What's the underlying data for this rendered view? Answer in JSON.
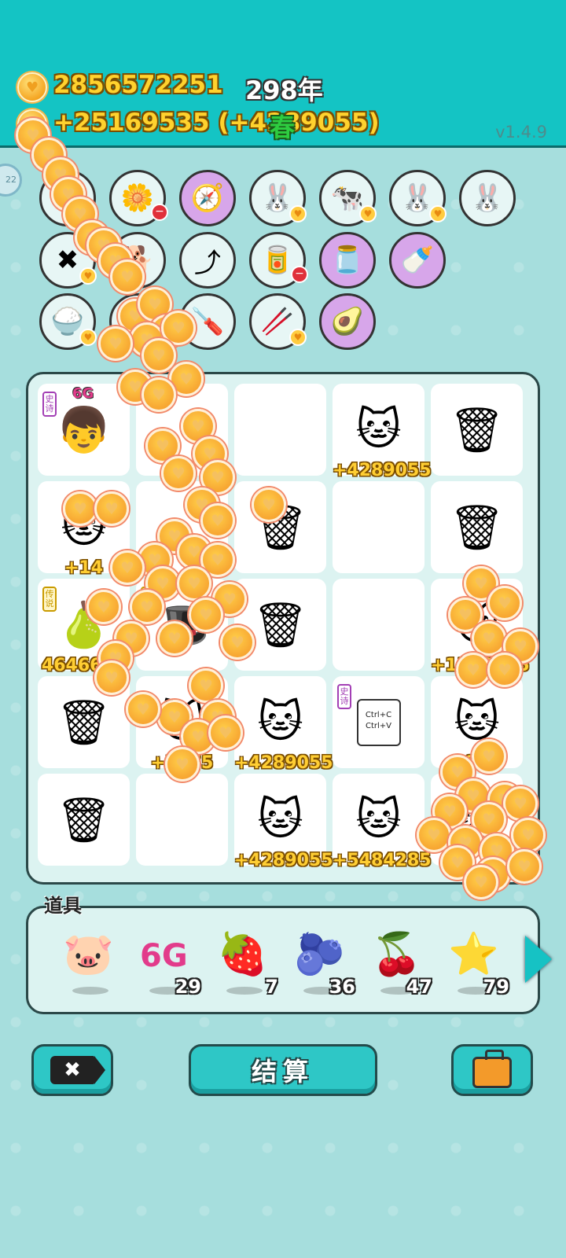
{
  "header": {
    "coins": "2856572251",
    "income": "+25169535 (+4289055)",
    "year": "298年",
    "season": "春",
    "version": "v1.4.9"
  },
  "side_bubble": "22",
  "skill_icons": [
    {
      "name": "cancel-icon",
      "glyph": "⊖",
      "style": "",
      "badge": "heart"
    },
    {
      "name": "flower-pot-icon",
      "glyph": "🌼",
      "style": "",
      "badge": "minus"
    },
    {
      "name": "compass-icon",
      "glyph": "🧭",
      "style": "purple",
      "badge": ""
    },
    {
      "name": "rabbit-icon",
      "glyph": "🐰",
      "style": "",
      "badge": "heart"
    },
    {
      "name": "milk-cow-icon",
      "glyph": "🐄",
      "style": "",
      "badge": "heart"
    },
    {
      "name": "rabbit-2-icon",
      "glyph": "🐰",
      "style": "",
      "badge": "heart"
    },
    {
      "name": "rabbit-3-icon",
      "glyph": "🐰",
      "style": "",
      "badge": ""
    },
    {
      "name": "close-tag-icon",
      "glyph": "✖",
      "style": "",
      "badge": "heart"
    },
    {
      "name": "cool-dog-icon",
      "glyph": "🐕",
      "style": "",
      "badge": ""
    },
    {
      "name": "arrow-up-icon",
      "glyph": "⤴",
      "style": "",
      "badge": ""
    },
    {
      "name": "canister-icon",
      "glyph": "🥫",
      "style": "",
      "badge": "minus"
    },
    {
      "name": "jar-icon",
      "glyph": "🫙",
      "style": "purple",
      "badge": ""
    },
    {
      "name": "breast-pump-icon",
      "glyph": "🍼",
      "style": "purple",
      "badge": ""
    },
    {
      "name": "rice-bowl-icon",
      "glyph": "🍚",
      "style": "",
      "badge": "heart"
    },
    {
      "name": "book-icon",
      "glyph": "📘",
      "style": "",
      "badge": ""
    },
    {
      "name": "screwdriver-icon",
      "glyph": "🪛",
      "style": "",
      "badge": ""
    },
    {
      "name": "chopsticks-icon",
      "glyph": "🥢",
      "style": "",
      "badge": "heart"
    },
    {
      "name": "avocado-icon",
      "glyph": "🥑",
      "style": "purple",
      "badge": ""
    }
  ],
  "board": [
    {
      "name": "cell-boy",
      "glyph": "👦",
      "label": "",
      "tag": "史诗",
      "tag_type": "epic",
      "extra": "6G"
    },
    {
      "name": "cell-empty",
      "glyph": "",
      "label": "",
      "tag": "",
      "tag_type": "",
      "extra": ""
    },
    {
      "name": "cell-empty",
      "glyph": "",
      "label": "",
      "tag": "",
      "tag_type": "",
      "extra": ""
    },
    {
      "name": "cell-cat",
      "glyph": "🐱",
      "label": "+4289055",
      "tag": "",
      "tag_type": "",
      "extra": ""
    },
    {
      "name": "cell-trash-bag",
      "glyph": "🗑",
      "label": "",
      "tag": "",
      "tag_type": "",
      "extra": ""
    },
    {
      "name": "cell-cat",
      "glyph": "🐱",
      "label": "+14",
      "tag": "",
      "tag_type": "",
      "extra": ""
    },
    {
      "name": "cell-empty",
      "glyph": "",
      "label": "",
      "tag": "",
      "tag_type": "",
      "extra": ""
    },
    {
      "name": "cell-trash-bag",
      "glyph": "🗑",
      "label": "",
      "tag": "",
      "tag_type": "",
      "extra": ""
    },
    {
      "name": "cell-empty",
      "glyph": "",
      "label": "",
      "tag": "",
      "tag_type": "",
      "extra": ""
    },
    {
      "name": "cell-trash-bag",
      "glyph": "🗑",
      "label": "",
      "tag": "",
      "tag_type": "",
      "extra": ""
    },
    {
      "name": "cell-pear",
      "glyph": "🍐",
      "label": "4646600",
      "tag": "传说",
      "tag_type": "legend",
      "extra": ""
    },
    {
      "name": "cell-hat",
      "glyph": "🎩",
      "label": "",
      "tag": "传",
      "tag_type": "legend",
      "extra": ""
    },
    {
      "name": "cell-trash-bag",
      "glyph": "🗑",
      "label": "",
      "tag": "",
      "tag_type": "",
      "extra": ""
    },
    {
      "name": "cell-empty",
      "glyph": "",
      "label": "",
      "tag": "",
      "tag_type": "",
      "extra": ""
    },
    {
      "name": "cell-cat",
      "glyph": "🐱",
      "label": "+1289055",
      "tag": "",
      "tag_type": "",
      "extra": ""
    },
    {
      "name": "cell-trash-bag",
      "glyph": "🗑",
      "label": "",
      "tag": "",
      "tag_type": "",
      "extra": ""
    },
    {
      "name": "cell-cat",
      "glyph": "🐱",
      "label": "+2675",
      "tag": "",
      "tag_type": "",
      "extra": ""
    },
    {
      "name": "cell-cat",
      "glyph": "🐱",
      "label": "+4289055",
      "tag": "",
      "tag_type": "",
      "extra": ""
    },
    {
      "name": "cell-ctrl-cv",
      "glyph": "",
      "label": "",
      "tag": "史诗",
      "tag_type": "epic",
      "extra": "Ctrl+C Ctrl+V"
    },
    {
      "name": "cell-cat",
      "glyph": "🐱",
      "label": "85",
      "tag": "",
      "tag_type": "",
      "extra": ""
    },
    {
      "name": "cell-trash-bag",
      "glyph": "🗑",
      "label": "",
      "tag": "",
      "tag_type": "",
      "extra": ""
    },
    {
      "name": "cell-empty",
      "glyph": "",
      "label": "",
      "tag": "",
      "tag_type": "",
      "extra": ""
    },
    {
      "name": "cell-cat",
      "glyph": "🐱",
      "label": "+4289055",
      "tag": "",
      "tag_type": "",
      "extra": ""
    },
    {
      "name": "cell-cat",
      "glyph": "🐱",
      "label": "+5484285",
      "tag": "",
      "tag_type": "",
      "extra": ""
    },
    {
      "name": "cell-cat",
      "glyph": "🐱",
      "label": "",
      "tag": "",
      "tag_type": "",
      "extra": ""
    }
  ],
  "props": {
    "title": "道具",
    "items": [
      {
        "name": "piggy-bank-icon",
        "glyph": "🐷",
        "count": ""
      },
      {
        "name": "6g-icon",
        "glyph": "6G",
        "count": "29"
      },
      {
        "name": "strawberry-icon",
        "glyph": "🍓",
        "count": "7"
      },
      {
        "name": "blueberry-icon",
        "glyph": "🫐",
        "count": "36"
      },
      {
        "name": "bayberry-icon",
        "glyph": "🍒",
        "count": "47"
      },
      {
        "name": "star-icon",
        "glyph": "⭐",
        "count": "79"
      }
    ]
  },
  "buttons": {
    "settle": "结算"
  }
}
